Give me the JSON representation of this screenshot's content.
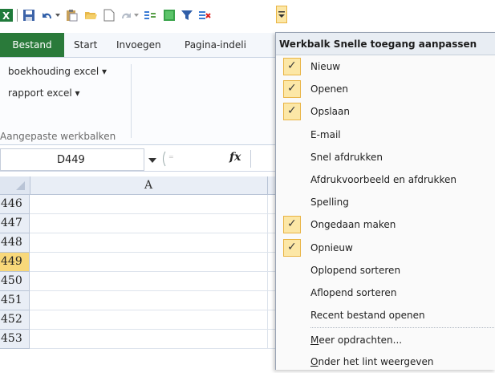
{
  "window": {
    "title": ""
  },
  "qat": {
    "icons": [
      "excel-logo-icon",
      "save-icon",
      "undo-icon",
      "paste-icon",
      "open-folder-icon",
      "new-document-icon",
      "redo-icon",
      "sort-icon",
      "chart-icon",
      "filter-icon",
      "clear-filter-icon",
      "customize-dropdown-icon"
    ]
  },
  "ribbon": {
    "tabs": {
      "file": "Bestand",
      "start": "Start",
      "insert": "Invoegen",
      "page_layout": "Pagina-indeli"
    },
    "items": [
      "boekhouding excel ▾",
      "rapport excel ▾"
    ],
    "group_label": "Aangepaste werkbalken"
  },
  "formula_bar": {
    "namebox": "D449",
    "fx": "fx"
  },
  "sheet": {
    "column_header": "A",
    "rows": [
      "446",
      "447",
      "448",
      "449",
      "450",
      "451",
      "452",
      "453"
    ],
    "selected_row": "449"
  },
  "menu": {
    "title": "Werkbalk Snelle toegang aanpassen",
    "items": [
      {
        "label": "Nieuw",
        "checked": true
      },
      {
        "label": "Openen",
        "checked": true
      },
      {
        "label": "Opslaan",
        "checked": true
      },
      {
        "label": "E-mail",
        "checked": false
      },
      {
        "label": "Snel afdrukken",
        "checked": false
      },
      {
        "label": "Afdrukvoorbeeld en afdrukken",
        "checked": false
      },
      {
        "label": "Spelling",
        "checked": false
      },
      {
        "label": "Ongedaan maken",
        "checked": true
      },
      {
        "label": "Opnieuw",
        "checked": true
      },
      {
        "label": "Oplopend sorteren",
        "checked": false
      },
      {
        "label": "Aflopend sorteren",
        "checked": false
      },
      {
        "label": "Recent bestand openen",
        "checked": false
      }
    ],
    "more": {
      "underline": "M",
      "rest": "eer opdrachten..."
    },
    "below": {
      "underline": "O",
      "rest": "nder het lint weergeven"
    },
    "check_glyph": "✓"
  },
  "colors": {
    "file_tab": "#2a7a3a",
    "check_bg": "#fce7a6",
    "check_border": "#e9b444",
    "selected_row": "#f8d87a"
  }
}
